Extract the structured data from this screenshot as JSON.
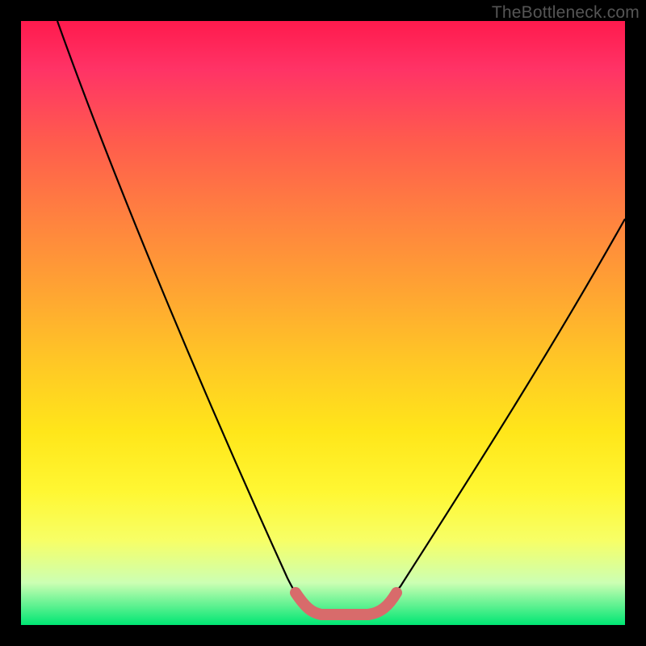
{
  "watermark": "TheBottleneck.com",
  "colors": {
    "background": "#000000",
    "curve": "#000000",
    "marker": "#d86b6b",
    "watermark_text": "#555555"
  },
  "chart_data": {
    "type": "line",
    "title": "",
    "xlabel": "",
    "ylabel": "",
    "xlim": [
      0,
      100
    ],
    "ylim": [
      0,
      100
    ],
    "series": [
      {
        "name": "bottleneck-curve",
        "x": [
          6,
          10,
          15,
          20,
          25,
          30,
          35,
          40,
          45,
          48,
          50,
          52,
          54,
          56,
          58,
          60,
          65,
          70,
          75,
          80,
          85,
          90,
          95,
          100
        ],
        "y": [
          100,
          90,
          78,
          66,
          55,
          44,
          33,
          23,
          12,
          6,
          3,
          2,
          2,
          2,
          2,
          3,
          7,
          14,
          22,
          31,
          40,
          50,
          59,
          68
        ]
      }
    ],
    "annotations": [
      {
        "name": "trough-marker",
        "x_range": [
          47,
          60
        ],
        "y_approx": 2
      }
    ],
    "grid": false,
    "legend": false
  }
}
